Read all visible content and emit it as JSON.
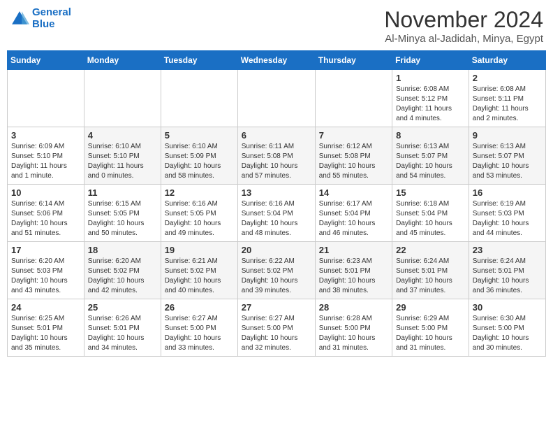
{
  "logo": {
    "line1": "General",
    "line2": "Blue"
  },
  "title": "November 2024",
  "location": "Al-Minya al-Jadidah, Minya, Egypt",
  "weekdays": [
    "Sunday",
    "Monday",
    "Tuesday",
    "Wednesday",
    "Thursday",
    "Friday",
    "Saturday"
  ],
  "weeks": [
    [
      {
        "day": "",
        "info": ""
      },
      {
        "day": "",
        "info": ""
      },
      {
        "day": "",
        "info": ""
      },
      {
        "day": "",
        "info": ""
      },
      {
        "day": "",
        "info": ""
      },
      {
        "day": "1",
        "info": "Sunrise: 6:08 AM\nSunset: 5:12 PM\nDaylight: 11 hours and 4 minutes."
      },
      {
        "day": "2",
        "info": "Sunrise: 6:08 AM\nSunset: 5:11 PM\nDaylight: 11 hours and 2 minutes."
      }
    ],
    [
      {
        "day": "3",
        "info": "Sunrise: 6:09 AM\nSunset: 5:10 PM\nDaylight: 11 hours and 1 minute."
      },
      {
        "day": "4",
        "info": "Sunrise: 6:10 AM\nSunset: 5:10 PM\nDaylight: 11 hours and 0 minutes."
      },
      {
        "day": "5",
        "info": "Sunrise: 6:10 AM\nSunset: 5:09 PM\nDaylight: 10 hours and 58 minutes."
      },
      {
        "day": "6",
        "info": "Sunrise: 6:11 AM\nSunset: 5:08 PM\nDaylight: 10 hours and 57 minutes."
      },
      {
        "day": "7",
        "info": "Sunrise: 6:12 AM\nSunset: 5:08 PM\nDaylight: 10 hours and 55 minutes."
      },
      {
        "day": "8",
        "info": "Sunrise: 6:13 AM\nSunset: 5:07 PM\nDaylight: 10 hours and 54 minutes."
      },
      {
        "day": "9",
        "info": "Sunrise: 6:13 AM\nSunset: 5:07 PM\nDaylight: 10 hours and 53 minutes."
      }
    ],
    [
      {
        "day": "10",
        "info": "Sunrise: 6:14 AM\nSunset: 5:06 PM\nDaylight: 10 hours and 51 minutes."
      },
      {
        "day": "11",
        "info": "Sunrise: 6:15 AM\nSunset: 5:05 PM\nDaylight: 10 hours and 50 minutes."
      },
      {
        "day": "12",
        "info": "Sunrise: 6:16 AM\nSunset: 5:05 PM\nDaylight: 10 hours and 49 minutes."
      },
      {
        "day": "13",
        "info": "Sunrise: 6:16 AM\nSunset: 5:04 PM\nDaylight: 10 hours and 48 minutes."
      },
      {
        "day": "14",
        "info": "Sunrise: 6:17 AM\nSunset: 5:04 PM\nDaylight: 10 hours and 46 minutes."
      },
      {
        "day": "15",
        "info": "Sunrise: 6:18 AM\nSunset: 5:04 PM\nDaylight: 10 hours and 45 minutes."
      },
      {
        "day": "16",
        "info": "Sunrise: 6:19 AM\nSunset: 5:03 PM\nDaylight: 10 hours and 44 minutes."
      }
    ],
    [
      {
        "day": "17",
        "info": "Sunrise: 6:20 AM\nSunset: 5:03 PM\nDaylight: 10 hours and 43 minutes."
      },
      {
        "day": "18",
        "info": "Sunrise: 6:20 AM\nSunset: 5:02 PM\nDaylight: 10 hours and 42 minutes."
      },
      {
        "day": "19",
        "info": "Sunrise: 6:21 AM\nSunset: 5:02 PM\nDaylight: 10 hours and 40 minutes."
      },
      {
        "day": "20",
        "info": "Sunrise: 6:22 AM\nSunset: 5:02 PM\nDaylight: 10 hours and 39 minutes."
      },
      {
        "day": "21",
        "info": "Sunrise: 6:23 AM\nSunset: 5:01 PM\nDaylight: 10 hours and 38 minutes."
      },
      {
        "day": "22",
        "info": "Sunrise: 6:24 AM\nSunset: 5:01 PM\nDaylight: 10 hours and 37 minutes."
      },
      {
        "day": "23",
        "info": "Sunrise: 6:24 AM\nSunset: 5:01 PM\nDaylight: 10 hours and 36 minutes."
      }
    ],
    [
      {
        "day": "24",
        "info": "Sunrise: 6:25 AM\nSunset: 5:01 PM\nDaylight: 10 hours and 35 minutes."
      },
      {
        "day": "25",
        "info": "Sunrise: 6:26 AM\nSunset: 5:01 PM\nDaylight: 10 hours and 34 minutes."
      },
      {
        "day": "26",
        "info": "Sunrise: 6:27 AM\nSunset: 5:00 PM\nDaylight: 10 hours and 33 minutes."
      },
      {
        "day": "27",
        "info": "Sunrise: 6:27 AM\nSunset: 5:00 PM\nDaylight: 10 hours and 32 minutes."
      },
      {
        "day": "28",
        "info": "Sunrise: 6:28 AM\nSunset: 5:00 PM\nDaylight: 10 hours and 31 minutes."
      },
      {
        "day": "29",
        "info": "Sunrise: 6:29 AM\nSunset: 5:00 PM\nDaylight: 10 hours and 31 minutes."
      },
      {
        "day": "30",
        "info": "Sunrise: 6:30 AM\nSunset: 5:00 PM\nDaylight: 10 hours and 30 minutes."
      }
    ]
  ]
}
